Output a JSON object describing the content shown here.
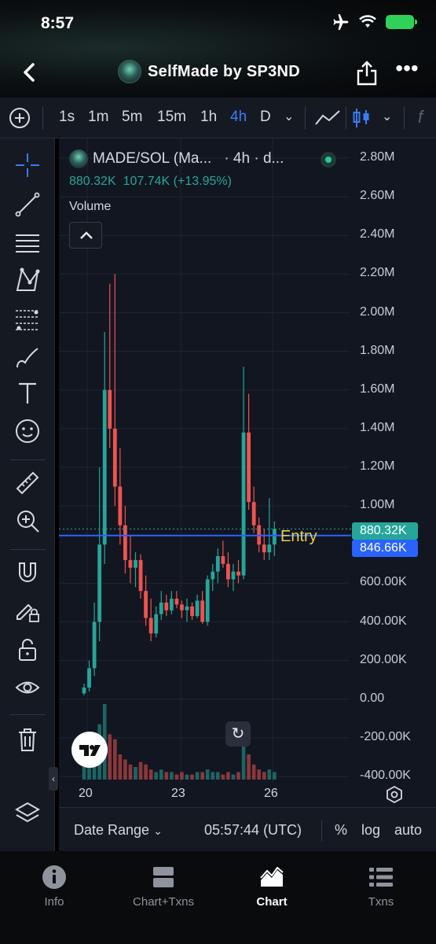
{
  "status": {
    "time": "8:57"
  },
  "header": {
    "title": "SelfMade by SP3ND"
  },
  "toolbar": {
    "timeframes": [
      "1s",
      "1m",
      "5m",
      "15m",
      "1h",
      "4h",
      "D"
    ],
    "active_timeframe": "4h"
  },
  "legend": {
    "symbol": "MADE/SOL (Ma...",
    "interval": "· 4h · d...",
    "price": "880.32K",
    "change": "107.74K (+13.95%)",
    "volume_label": "Volume"
  },
  "annotations": {
    "entry_label": "Entry",
    "last_price_tag": "880.32K",
    "entry_price_tag": "846.66K"
  },
  "bottom_bar": {
    "date_range": "Date Range",
    "clock": "05:57:44 (UTC)",
    "percent": "%",
    "log": "log",
    "auto": "auto"
  },
  "tabs": [
    {
      "label": "Info",
      "icon": "info-icon"
    },
    {
      "label": "Chart+Txns",
      "icon": "split-view-icon"
    },
    {
      "label": "Chart",
      "icon": "area-chart-icon"
    },
    {
      "label": "Txns",
      "icon": "list-icon"
    }
  ],
  "active_tab": "Chart",
  "colors": {
    "up": "#26a69a",
    "down": "#ef5350",
    "accent": "#3a7cf6",
    "entry_line": "#2962ff"
  },
  "chart_data": {
    "type": "candlestick",
    "title": "",
    "y_tick_labels": [
      "2.80M",
      "2.60M",
      "2.40M",
      "2.20M",
      "2.00M",
      "1.80M",
      "1.60M",
      "1.40M",
      "1.20M",
      "1.00M",
      "600.00K",
      "400.00K",
      "200.00K",
      "0.00",
      "-200.00K",
      "-400.00K"
    ],
    "y_ticks": [
      2800000,
      2600000,
      2400000,
      2200000,
      2000000,
      1800000,
      1600000,
      1400000,
      1200000,
      1000000,
      600000,
      400000,
      200000,
      0,
      -200000,
      -400000
    ],
    "ylim": [
      -400000,
      2800000
    ],
    "x_tick_labels": [
      "20",
      "23",
      "26"
    ],
    "x_ticks": [
      3,
      23,
      43
    ],
    "entry_price": 846660,
    "last_price": 880320,
    "candles": [
      {
        "o": 30000,
        "h": 80000,
        "l": 20000,
        "c": 60000
      },
      {
        "o": 60000,
        "h": 200000,
        "l": 40000,
        "c": 160000
      },
      {
        "o": 160000,
        "h": 500000,
        "l": 120000,
        "c": 400000
      },
      {
        "o": 400000,
        "h": 1200000,
        "l": 300000,
        "c": 800000
      },
      {
        "o": 800000,
        "h": 1900000,
        "l": 700000,
        "c": 1600000
      },
      {
        "o": 1600000,
        "h": 2150000,
        "l": 1300000,
        "c": 1400000
      },
      {
        "o": 1400000,
        "h": 2200000,
        "l": 1000000,
        "c": 1100000
      },
      {
        "o": 1100000,
        "h": 1300000,
        "l": 800000,
        "c": 900000
      },
      {
        "o": 900000,
        "h": 1000000,
        "l": 650000,
        "c": 720000
      },
      {
        "o": 720000,
        "h": 850000,
        "l": 600000,
        "c": 680000
      },
      {
        "o": 680000,
        "h": 760000,
        "l": 580000,
        "c": 720000
      },
      {
        "o": 720000,
        "h": 750000,
        "l": 520000,
        "c": 560000
      },
      {
        "o": 560000,
        "h": 640000,
        "l": 380000,
        "c": 420000
      },
      {
        "o": 420000,
        "h": 520000,
        "l": 300000,
        "c": 340000
      },
      {
        "o": 340000,
        "h": 480000,
        "l": 320000,
        "c": 440000
      },
      {
        "o": 440000,
        "h": 560000,
        "l": 410000,
        "c": 500000
      },
      {
        "o": 500000,
        "h": 540000,
        "l": 430000,
        "c": 460000
      },
      {
        "o": 460000,
        "h": 560000,
        "l": 440000,
        "c": 520000
      },
      {
        "o": 520000,
        "h": 560000,
        "l": 470000,
        "c": 490000
      },
      {
        "o": 490000,
        "h": 510000,
        "l": 420000,
        "c": 460000
      },
      {
        "o": 460000,
        "h": 520000,
        "l": 400000,
        "c": 480000
      },
      {
        "o": 480000,
        "h": 500000,
        "l": 410000,
        "c": 430000
      },
      {
        "o": 430000,
        "h": 540000,
        "l": 420000,
        "c": 510000
      },
      {
        "o": 510000,
        "h": 560000,
        "l": 390000,
        "c": 400000
      },
      {
        "o": 400000,
        "h": 640000,
        "l": 380000,
        "c": 620000
      },
      {
        "o": 620000,
        "h": 700000,
        "l": 560000,
        "c": 660000
      },
      {
        "o": 660000,
        "h": 780000,
        "l": 600000,
        "c": 740000
      },
      {
        "o": 740000,
        "h": 820000,
        "l": 680000,
        "c": 700000
      },
      {
        "o": 700000,
        "h": 760000,
        "l": 580000,
        "c": 620000
      },
      {
        "o": 620000,
        "h": 700000,
        "l": 560000,
        "c": 660000
      },
      {
        "o": 660000,
        "h": 720000,
        "l": 600000,
        "c": 640000
      },
      {
        "o": 640000,
        "h": 1720000,
        "l": 620000,
        "c": 1380000
      },
      {
        "o": 1380000,
        "h": 1580000,
        "l": 980000,
        "c": 1020000
      },
      {
        "o": 1020000,
        "h": 1100000,
        "l": 860000,
        "c": 900000
      },
      {
        "o": 900000,
        "h": 940000,
        "l": 760000,
        "c": 800000
      },
      {
        "o": 800000,
        "h": 880000,
        "l": 720000,
        "c": 760000
      },
      {
        "o": 760000,
        "h": 1040000,
        "l": 720000,
        "c": 800000
      },
      {
        "o": 800000,
        "h": 920000,
        "l": 740000,
        "c": 880320
      }
    ],
    "volume": [
      5,
      9,
      14,
      22,
      30,
      18,
      16,
      10,
      8,
      6,
      5,
      7,
      6,
      4,
      3,
      4,
      3,
      3,
      2,
      3,
      2,
      2,
      3,
      3,
      4,
      3,
      3,
      2,
      3,
      2,
      3,
      14,
      10,
      6,
      4,
      3,
      4,
      3
    ],
    "volume_colors_up": [
      true,
      true,
      true,
      true,
      true,
      false,
      false,
      false,
      false,
      false,
      true,
      false,
      false,
      false,
      true,
      true,
      false,
      true,
      false,
      false,
      true,
      false,
      true,
      false,
      true,
      true,
      true,
      false,
      false,
      true,
      false,
      true,
      false,
      false,
      false,
      false,
      true,
      true
    ]
  }
}
